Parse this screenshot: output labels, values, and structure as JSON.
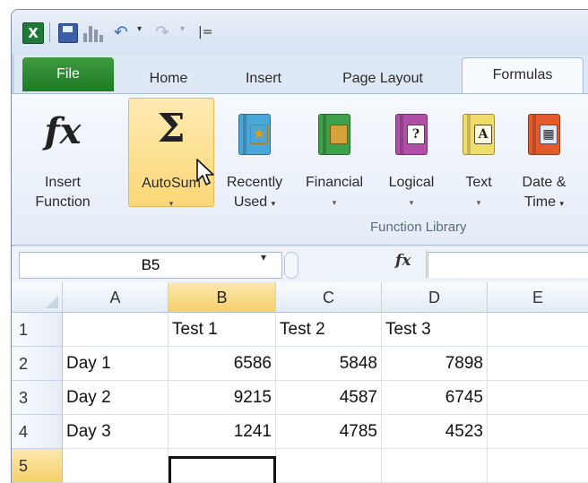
{
  "qat": {
    "app_icon": "X",
    "icons": [
      "excel-icon",
      "save-icon",
      "chart-icon",
      "undo-icon",
      "redo-icon",
      "customize-icon"
    ],
    "undo_glyph": "↶",
    "redo_glyph": "↷",
    "dropdown_glyph": "▾",
    "customize_glyph": "|=",
    "app_icon_color": "#1f7a3a"
  },
  "tabs": [
    "File",
    "Home",
    "Insert",
    "Page Layout",
    "Formulas"
  ],
  "active_tab": "Formulas",
  "ribbon": {
    "insert_function": {
      "icon_text": "fx",
      "line1": "Insert",
      "line2": "Function"
    },
    "autosum": {
      "icon_text": "Σ",
      "label": "AutoSum"
    },
    "recently_used": {
      "line1": "Recently",
      "line2": "Used"
    },
    "financial": {
      "label": "Financial"
    },
    "logical": {
      "label": "Logical",
      "icon_text": "?"
    },
    "text": {
      "label": "Text",
      "icon_text": "A"
    },
    "date_time": {
      "line1": "Date &",
      "line2": "Time"
    },
    "group_label": "Function Library",
    "dropdown_glyph": "▾",
    "book_colors": {
      "recently_used": "#4aa6d6",
      "financial": "#3fa04a",
      "logical": "#b04ea8",
      "text": "#f1dd6a",
      "date_time": "#e35a2c"
    },
    "highlight_color": "#fcd776"
  },
  "formula_bar": {
    "name_box": "B5",
    "dropdown_glyph": "▾",
    "fx_label": "fx",
    "value": ""
  },
  "grid": {
    "columns": [
      "A",
      "B",
      "C",
      "D",
      "E"
    ],
    "rows": [
      "1",
      "2",
      "3",
      "4",
      "5"
    ],
    "selected_column": "B",
    "selected_row": "5",
    "cells": [
      [
        "",
        "Test 1",
        "Test 2",
        "Test 3",
        ""
      ],
      [
        "Day 1",
        "6586",
        "5848",
        "7898",
        ""
      ],
      [
        "Day 2",
        "9215",
        "4587",
        "6745",
        ""
      ],
      [
        "Day 3",
        "1241",
        "4785",
        "4523",
        ""
      ],
      [
        "",
        "",
        "",
        "",
        ""
      ]
    ],
    "selection_color": "#f6cf6a"
  }
}
